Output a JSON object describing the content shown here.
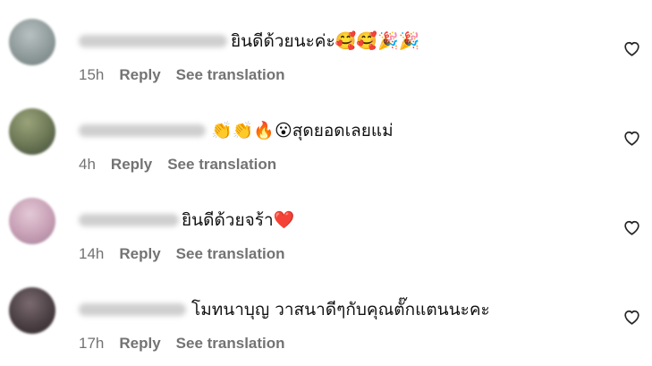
{
  "comments": [
    {
      "text": "ยินดีด้วยนะค่ะ🥰🥰🎉🎉",
      "time": "15h",
      "reply_label": "Reply",
      "translate_label": "See translation",
      "avatar_color": "#8f9a9a"
    },
    {
      "text": "👏👏🔥😮สุดยอดเลยแม่",
      "time": "4h",
      "reply_label": "Reply",
      "translate_label": "See translation",
      "avatar_color": "#6f7a57"
    },
    {
      "text": "ยินดีด้วยจร้า❤️",
      "time": "14h",
      "reply_label": "Reply",
      "translate_label": "See translation",
      "avatar_color": "#c79fb5"
    },
    {
      "text": "โมทนาบุญ วาสนาดีๆกับคุณตั๊กแตนนะคะ",
      "time": "17h",
      "reply_label": "Reply",
      "translate_label": "See translation",
      "avatar_color": "#4b4044"
    }
  ],
  "colors": {
    "meta_text": "#737373",
    "comment_text": "#111111",
    "heart_stroke": "#262626"
  },
  "icons": {
    "like": "heart-outline-icon"
  }
}
